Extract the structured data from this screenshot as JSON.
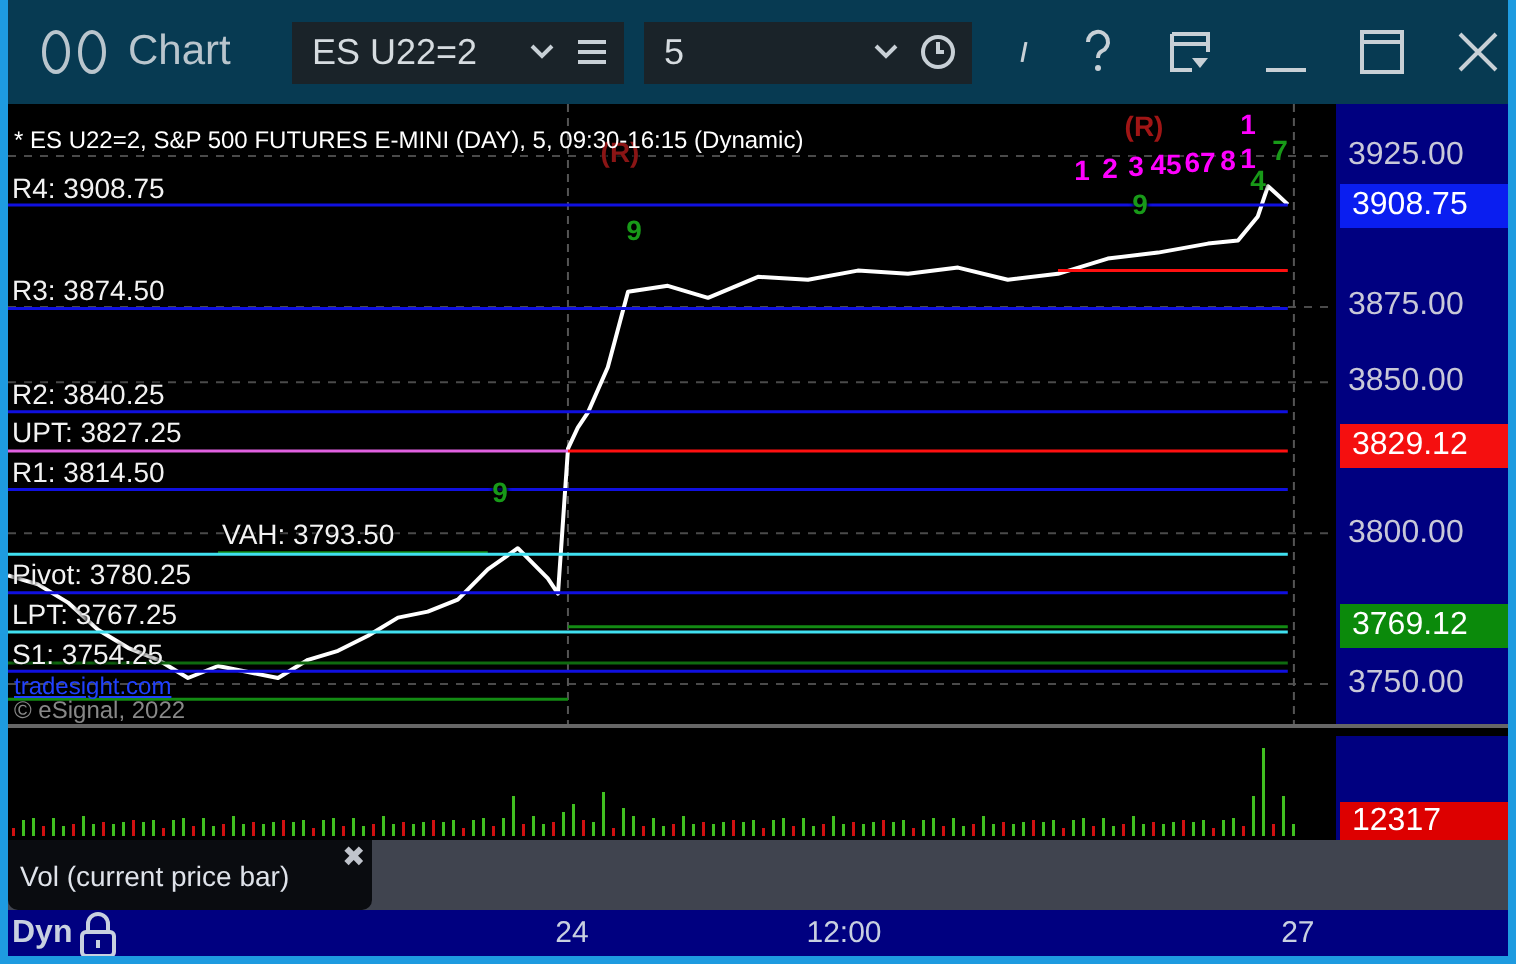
{
  "window": {
    "title": "Chart"
  },
  "toolbar": {
    "symbol": "ES U22=2",
    "interval": "5"
  },
  "chart": {
    "header": "* ES U22=2, S&P 500 FUTURES E-MINI (DAY), 5, 09:30-16:15 (Dynamic)",
    "overlay_texts": [
      {
        "kind": "link",
        "text": "tradesight.com"
      },
      {
        "kind": "note",
        "text": "© eSignal, 2022"
      }
    ],
    "markers": [
      {
        "text": "(R)",
        "color": "#8a1515"
      },
      {
        "text": "(R)",
        "color": "#a01515"
      },
      {
        "text": "1",
        "color": "#ff00ff"
      },
      {
        "text": "2",
        "color": "#ff00ff"
      },
      {
        "text": "3",
        "color": "#ff00ff"
      },
      {
        "text": "45",
        "color": "#ff00ff"
      },
      {
        "text": "67",
        "color": "#ff00ff"
      },
      {
        "text": "8",
        "color": "#ff00ff"
      },
      {
        "text": "1",
        "color": "#ff00ff"
      },
      {
        "text": "1",
        "color": "#ff00ff"
      },
      {
        "text": "9",
        "color": "#189a18"
      },
      {
        "text": "9",
        "color": "#189a18"
      },
      {
        "text": "9",
        "color": "#189a18"
      },
      {
        "text": "7",
        "color": "#189a18"
      },
      {
        "text": "4",
        "color": "#189a18"
      }
    ],
    "price_badges": [
      {
        "text": "3908.75",
        "color": "#0a1ef0"
      },
      {
        "text": "3829.12",
        "color": "#f50f0f"
      },
      {
        "text": "3769.12",
        "color": "#0b8a0b"
      }
    ],
    "chart_data": {
      "type": "line",
      "xlim": [
        21.686,
        27.174
      ],
      "ylim": [
        3736.75,
        3942.25
      ],
      "x": [
        21.686,
        21.81,
        21.934,
        22.058,
        22.182,
        22.306,
        22.43,
        22.554,
        22.678,
        22.802,
        22.926,
        23.05,
        23.174,
        23.298,
        23.421,
        23.545,
        23.669,
        23.793,
        23.917,
        23.959,
        24,
        24.041,
        24.083,
        24.165,
        24.248,
        24.413,
        24.579,
        24.785,
        24.992,
        25.198,
        25.405,
        25.612,
        25.818,
        26.025,
        26.231,
        26.438,
        26.645,
        26.769,
        26.851,
        26.893,
        26.934,
        26.975
      ],
      "series": [
        {
          "color": "#ffffff",
          "values": [
            3786,
            3783,
            3777,
            3768,
            3762,
            3758,
            3752,
            3756,
            3754,
            3752,
            3758,
            3761,
            3766,
            3772,
            3774,
            3778,
            3788,
            3795,
            3785,
            3780,
            3828,
            3835,
            3840,
            3855,
            3880,
            3882,
            3878,
            3885,
            3884,
            3887,
            3886,
            3888,
            3884,
            3886,
            3891,
            3893,
            3896,
            3897,
            3905,
            3915,
            3912,
            3909
          ]
        },
        {
          "name": "R4: 3908.75",
          "color": "#1010e0",
          "values": [
            3908.75,
            3908.75,
            3908.75,
            3908.75,
            3908.75,
            3908.75,
            3908.75,
            3908.75,
            3908.75,
            3908.75,
            3908.75,
            3908.75,
            3908.75,
            3908.75,
            3908.75,
            3908.75,
            3908.75,
            3908.75,
            3908.75,
            3908.75,
            3908.75,
            3908.75,
            3908.75,
            3908.75,
            3908.75,
            3908.75,
            3908.75,
            3908.75,
            3908.75,
            3908.75,
            3908.75,
            3908.75,
            3908.75,
            3908.75,
            3908.75,
            3908.75,
            3908.75,
            3908.75,
            3908.75,
            3908.75,
            3908.75,
            3908.75
          ]
        },
        {
          "name": "R3: 3874.50",
          "color": "#1010e0",
          "values": [
            3874.5,
            3874.5,
            3874.5,
            3874.5,
            3874.5,
            3874.5,
            3874.5,
            3874.5,
            3874.5,
            3874.5,
            3874.5,
            3874.5,
            3874.5,
            3874.5,
            3874.5,
            3874.5,
            3874.5,
            3874.5,
            3874.5,
            3874.5,
            3874.5,
            3874.5,
            3874.5,
            3874.5,
            3874.5,
            3874.5,
            3874.5,
            3874.5,
            3874.5,
            3874.5,
            3874.5,
            3874.5,
            3874.5,
            3874.5,
            3874.5,
            3874.5,
            3874.5,
            3874.5,
            3874.5,
            3874.5,
            3874.5,
            3874.5
          ]
        },
        {
          "name": "R2: 3840.25",
          "color": "#1010e0",
          "values": [
            3840.25,
            3840.25,
            3840.25,
            3840.25,
            3840.25,
            3840.25,
            3840.25,
            3840.25,
            3840.25,
            3840.25,
            3840.25,
            3840.25,
            3840.25,
            3840.25,
            3840.25,
            3840.25,
            3840.25,
            3840.25,
            3840.25,
            3840.25,
            3840.25,
            3840.25,
            3840.25,
            3840.25,
            3840.25,
            3840.25,
            3840.25,
            3840.25,
            3840.25,
            3840.25,
            3840.25,
            3840.25,
            3840.25,
            3840.25,
            3840.25,
            3840.25,
            3840.25,
            3840.25,
            3840.25,
            3840.25,
            3840.25,
            3840.25
          ]
        },
        {
          "name": "UPT: 3827.25",
          "color": "#e060e0",
          "values": [
            3827.25,
            3827.25,
            3827.25,
            3827.25,
            3827.25,
            3827.25,
            3827.25,
            3827.25,
            3827.25,
            3827.25,
            3827.25,
            3827.25,
            3827.25,
            3827.25,
            3827.25,
            3827.25,
            3827.25,
            3827.25,
            3827.25,
            3827.25,
            3827.25,
            null,
            null,
            null,
            null,
            null,
            null,
            null,
            null,
            null,
            null,
            null,
            null,
            null,
            null,
            null,
            null,
            null,
            null,
            null,
            null,
            null
          ]
        },
        {
          "color": "#ff1010",
          "values": [
            null,
            null,
            null,
            null,
            null,
            null,
            null,
            null,
            null,
            null,
            null,
            null,
            null,
            null,
            null,
            null,
            null,
            null,
            null,
            null,
            3827.25,
            3827.25,
            3827.25,
            3827.25,
            3827.25,
            3827.25,
            3827.25,
            3827.25,
            3827.25,
            3827.25,
            3827.25,
            3827.25,
            3827.25,
            3827.25,
            3827.25,
            3827.25,
            3827.25,
            3827.25,
            3827.25,
            3827.25,
            3827.25,
            3827.25
          ]
        },
        {
          "name": "R1: 3814.50",
          "color": "#1010e0",
          "values": [
            3814.5,
            3814.5,
            3814.5,
            3814.5,
            3814.5,
            3814.5,
            3814.5,
            3814.5,
            3814.5,
            3814.5,
            3814.5,
            3814.5,
            3814.5,
            3814.5,
            3814.5,
            3814.5,
            3814.5,
            3814.5,
            3814.5,
            3814.5,
            3814.5,
            3814.5,
            3814.5,
            3814.5,
            3814.5,
            3814.5,
            3814.5,
            3814.5,
            3814.5,
            3814.5,
            3814.5,
            3814.5,
            3814.5,
            3814.5,
            3814.5,
            3814.5,
            3814.5,
            3814.5,
            3814.5,
            3814.5,
            3814.5,
            3814.5
          ]
        },
        {
          "name": "VAH: 3793.50",
          "color": "#138a13",
          "values": [
            null,
            null,
            null,
            null,
            null,
            null,
            null,
            3793.5,
            3793.5,
            3793.5,
            3793.5,
            3793.5,
            3793.5,
            3793.5,
            3793.5,
            3793.5,
            3793.5,
            null,
            null,
            null,
            null,
            null,
            null,
            null,
            null,
            null,
            null,
            null,
            null,
            null,
            null,
            null,
            null,
            null,
            null,
            null,
            null,
            null,
            null,
            null,
            null,
            null
          ]
        },
        {
          "color": "#40e0f0",
          "values": [
            3793,
            3793,
            3793,
            3793,
            3793,
            3793,
            3793,
            3793,
            3793,
            3793,
            3793,
            3793,
            3793,
            3793,
            3793,
            3793,
            3793,
            3793,
            3793,
            3793,
            3793,
            3793,
            3793,
            3793,
            3793,
            3793,
            3793,
            3793,
            3793,
            3793,
            3793,
            3793,
            3793,
            3793,
            3793,
            3793,
            3793,
            3793,
            3793,
            3793,
            3793,
            3793
          ]
        },
        {
          "name": "Pivot: 3780.25",
          "color": "#1010e0",
          "values": [
            3780.25,
            3780.25,
            3780.25,
            3780.25,
            3780.25,
            3780.25,
            3780.25,
            3780.25,
            3780.25,
            3780.25,
            3780.25,
            3780.25,
            3780.25,
            3780.25,
            3780.25,
            3780.25,
            3780.25,
            3780.25,
            3780.25,
            3780.25,
            3780.25,
            3780.25,
            3780.25,
            3780.25,
            3780.25,
            3780.25,
            3780.25,
            3780.25,
            3780.25,
            3780.25,
            3780.25,
            3780.25,
            3780.25,
            3780.25,
            3780.25,
            3780.25,
            3780.25,
            3780.25,
            3780.25,
            3780.25,
            3780.25,
            3780.25
          ]
        },
        {
          "color": "#138a13",
          "values": [
            null,
            null,
            null,
            null,
            null,
            null,
            null,
            null,
            null,
            null,
            null,
            null,
            null,
            null,
            null,
            null,
            null,
            null,
            null,
            null,
            3769,
            3769,
            3769,
            3769,
            3769,
            3769,
            3769,
            3769,
            3769,
            3769,
            3769,
            3769,
            3769,
            3769,
            3769,
            3769,
            3769,
            3769,
            3769,
            3769,
            3769,
            3769
          ]
        },
        {
          "name": "LPT: 3767.25",
          "color": "#40e0f0",
          "values": [
            3767.25,
            3767.25,
            3767.25,
            3767.25,
            3767.25,
            3767.25,
            3767.25,
            3767.25,
            3767.25,
            3767.25,
            3767.25,
            3767.25,
            3767.25,
            3767.25,
            3767.25,
            3767.25,
            3767.25,
            3767.25,
            3767.25,
            3767.25,
            3767.25,
            3767.25,
            3767.25,
            3767.25,
            3767.25,
            3767.25,
            3767.25,
            3767.25,
            3767.25,
            3767.25,
            3767.25,
            3767.25,
            3767.25,
            3767.25,
            3767.25,
            3767.25,
            3767.25,
            3767.25,
            3767.25,
            3767.25,
            3767.25,
            3767.25
          ]
        },
        {
          "color": "#0f6a0f",
          "values": [
            3757,
            3757,
            3757,
            3757,
            3757,
            3757,
            3757,
            3757,
            3757,
            3757,
            3757,
            3757,
            3757,
            3757,
            3757,
            3757,
            3757,
            3757,
            3757,
            3757,
            3757,
            3757,
            3757,
            3757,
            3757,
            3757,
            3757,
            3757,
            3757,
            3757,
            3757,
            3757,
            3757,
            3757,
            3757,
            3757,
            3757,
            3757,
            3757,
            3757,
            3757,
            3757
          ]
        },
        {
          "name": "S1: 3754.25",
          "color": "#1010e0",
          "values": [
            3754.25,
            3754.25,
            3754.25,
            3754.25,
            3754.25,
            3754.25,
            3754.25,
            3754.25,
            3754.25,
            3754.25,
            3754.25,
            3754.25,
            3754.25,
            3754.25,
            3754.25,
            3754.25,
            3754.25,
            3754.25,
            3754.25,
            3754.25,
            3754.25,
            3754.25,
            3754.25,
            3754.25,
            3754.25,
            3754.25,
            3754.25,
            3754.25,
            3754.25,
            3754.25,
            3754.25,
            3754.25,
            3754.25,
            3754.25,
            3754.25,
            3754.25,
            3754.25,
            3754.25,
            3754.25,
            3754.25,
            3754.25,
            3754.25
          ]
        },
        {
          "color": "#138a13",
          "values": [
            3745,
            3745,
            3745,
            3745,
            3745,
            3745,
            3745,
            3745,
            3745,
            3745,
            3745,
            3745,
            3745,
            3745,
            3745,
            3745,
            3745,
            3745,
            3745,
            3745,
            3745,
            null,
            null,
            null,
            null,
            null,
            null,
            null,
            null,
            null,
            null,
            null,
            null,
            null,
            null,
            null,
            null,
            null,
            null,
            null,
            null,
            null
          ]
        },
        {
          "color": "#ff1010",
          "values": [
            null,
            null,
            null,
            null,
            null,
            null,
            null,
            null,
            null,
            null,
            null,
            null,
            null,
            null,
            null,
            null,
            null,
            null,
            null,
            null,
            null,
            null,
            null,
            null,
            null,
            null,
            null,
            null,
            null,
            null,
            null,
            null,
            null,
            3887,
            3887,
            3887,
            3887,
            3887,
            3887,
            3887,
            3887,
            3887
          ]
        }
      ],
      "xticks": [
        {
          "value": 24,
          "label": "24"
        },
        {
          "value": 27,
          "label": "27"
        }
      ],
      "yticks": [
        {
          "value": 3925,
          "label": "3925.00"
        },
        {
          "value": 3875,
          "label": "3875.00"
        },
        {
          "value": 3850,
          "label": "3850.00"
        },
        {
          "value": 3800,
          "label": "3800.00"
        },
        {
          "value": 3750,
          "label": "3750.00"
        }
      ],
      "grid": true
    }
  },
  "volume": {
    "reading": "12317"
  },
  "indicator_pane": {
    "label": "Vol (current price bar)",
    "close": "✖"
  },
  "status_bar": {
    "mode": "Dyn",
    "locked": true,
    "time_label": "12:00"
  }
}
